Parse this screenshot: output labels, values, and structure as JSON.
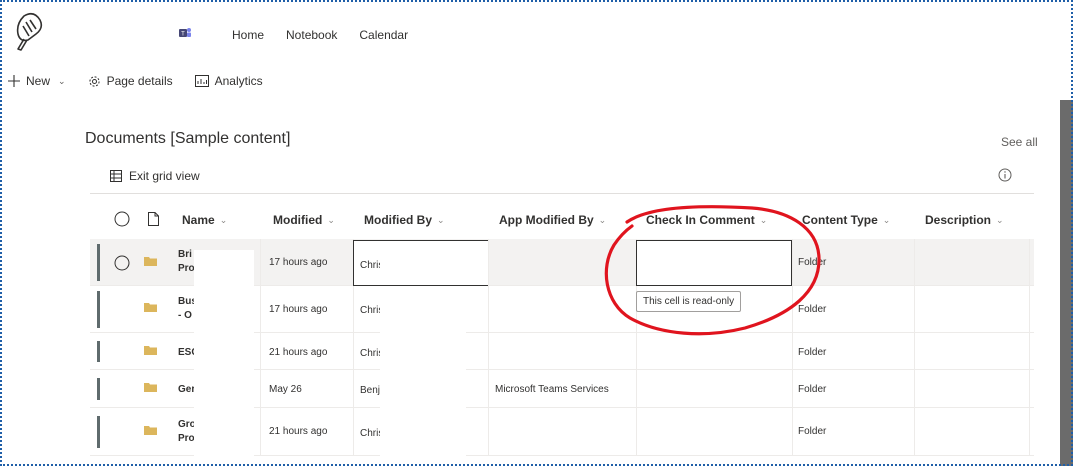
{
  "nav": {
    "home": "Home",
    "notebook": "Notebook",
    "calendar": "Calendar"
  },
  "command_bar": {
    "new": "New",
    "page_details": "Page details",
    "analytics": "Analytics"
  },
  "library": {
    "title": "Documents [Sample content]",
    "see_all": "See all",
    "exit_grid": "Exit grid view",
    "columns": {
      "name": "Name",
      "modified": "Modified",
      "modified_by": "Modified By",
      "app_modified_by": "App Modified By",
      "check_in_comment": "Check In Comment",
      "content_type": "Content Type",
      "description": "Description"
    },
    "rows": [
      {
        "name": "Bri\nPro",
        "modified": "17 hours ago",
        "modified_by": "Chris",
        "app_modified_by": "",
        "content_type": "Folder"
      },
      {
        "name": "Bus\n- O",
        "modified": "17 hours ago",
        "modified_by": "Chris",
        "app_modified_by": "",
        "content_type": "Folder"
      },
      {
        "name": "ESC",
        "modified": "21 hours ago",
        "modified_by": "Chris",
        "app_modified_by": "",
        "content_type": "Folder"
      },
      {
        "name": "Ger",
        "modified": "May 26",
        "modified_by": "Benj",
        "app_modified_by": "Microsoft Teams Services",
        "content_type": "Folder"
      },
      {
        "name": "Gro\nPro",
        "modified": "21 hours ago",
        "modified_by": "Chris",
        "app_modified_by": "",
        "content_type": "Folder"
      }
    ],
    "tooltip": "This cell is read-only"
  },
  "colors": {
    "row_bar": "#5f6b6d",
    "folder": "#dcb65c",
    "annotation": "#e0141e",
    "frame": "#1f5fa8"
  }
}
